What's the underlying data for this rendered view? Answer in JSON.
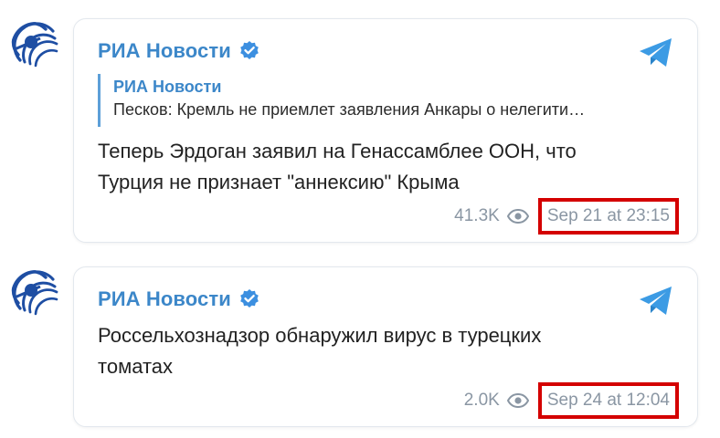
{
  "posts": [
    {
      "channel": "РИА Новости",
      "reply": {
        "name": "РИА Новости",
        "text": "Песков: Кремль не приемлет заявления Анкары о нелегити…"
      },
      "message_lines": [
        "Теперь Эрдоган заявил на Генассамблее ООН, что",
        "Турция не признает \"аннексию\" Крыма"
      ],
      "views": "41.3K",
      "date": "Sep 21 at 23:15"
    },
    {
      "channel": "РИА Новости",
      "message_lines": [
        "Россельхознадзор обнаружил вирус в турецких",
        "томатах"
      ],
      "views": "2.0K",
      "date": "Sep 24 at 12:04"
    }
  ],
  "icons": {
    "avatar": "ria-logo-icon",
    "verified": "verified-check-icon",
    "telegram": "telegram-plane-icon",
    "views": "eye-icon"
  },
  "colors": {
    "accent": "#3c87c9",
    "highlight_box": "#d40000",
    "meta_text": "#8a96a3"
  }
}
